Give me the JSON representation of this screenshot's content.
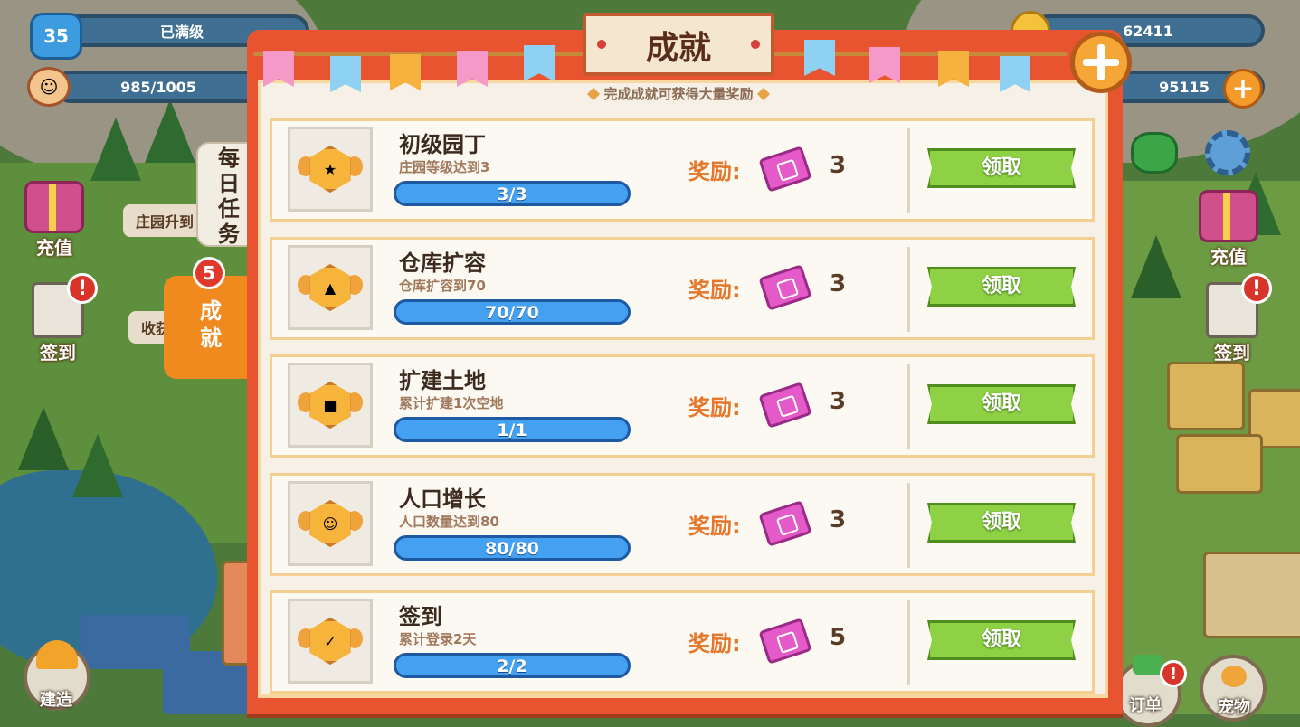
{
  "hud": {
    "level": "35",
    "level_status": "已满级",
    "population": "985/1005",
    "coins": "62411",
    "gems": "95115",
    "plus_symbol": "+"
  },
  "left_side": {
    "recharge_label": "充值",
    "checkin_label": "签到",
    "checkin_alert": "!",
    "speech_1": "庄园升到",
    "speech_2": "收获",
    "build_label": "建造"
  },
  "right_side": {
    "recharge_label": "充值",
    "checkin_label": "签到",
    "checkin_alert": "!",
    "order_label": "订单",
    "order_alert": "!",
    "pet_label": "宠物"
  },
  "tabs": {
    "daily": "每日任务",
    "achievement": "成就",
    "achievement_badge": "5"
  },
  "panel": {
    "title": "成就",
    "subtitle": "完成成就可获得大量奖励",
    "reward_label": "奖励:",
    "claim_label": "领取"
  },
  "achievements": [
    {
      "title": "初级园丁",
      "desc": "庄园等级达到3",
      "progress": "3/3",
      "progress_fraction": 1,
      "reward": "3",
      "icon": "exp-star-icon"
    },
    {
      "title": "仓库扩容",
      "desc": "仓库扩容到70",
      "progress": "70/70",
      "progress_fraction": 1,
      "reward": "3",
      "icon": "warehouse-icon"
    },
    {
      "title": "扩建土地",
      "desc": "累计扩建1次空地",
      "progress": "1/1",
      "progress_fraction": 1,
      "reward": "3",
      "icon": "land-icon"
    },
    {
      "title": "人口增长",
      "desc": "人口数量达到80",
      "progress": "80/80",
      "progress_fraction": 1,
      "reward": "3",
      "icon": "people-icon"
    },
    {
      "title": "签到",
      "desc": "累计登录2天",
      "progress": "2/2",
      "progress_fraction": 1,
      "reward": "5",
      "icon": "checkin-clipboard-icon"
    }
  ],
  "colors": {
    "panel_red": "#e8542f",
    "claim_green": "#8fd145",
    "progress_blue": "#3b8fe0",
    "ticket_pink": "#e35ac8",
    "tab_orange": "#f08a1f"
  }
}
